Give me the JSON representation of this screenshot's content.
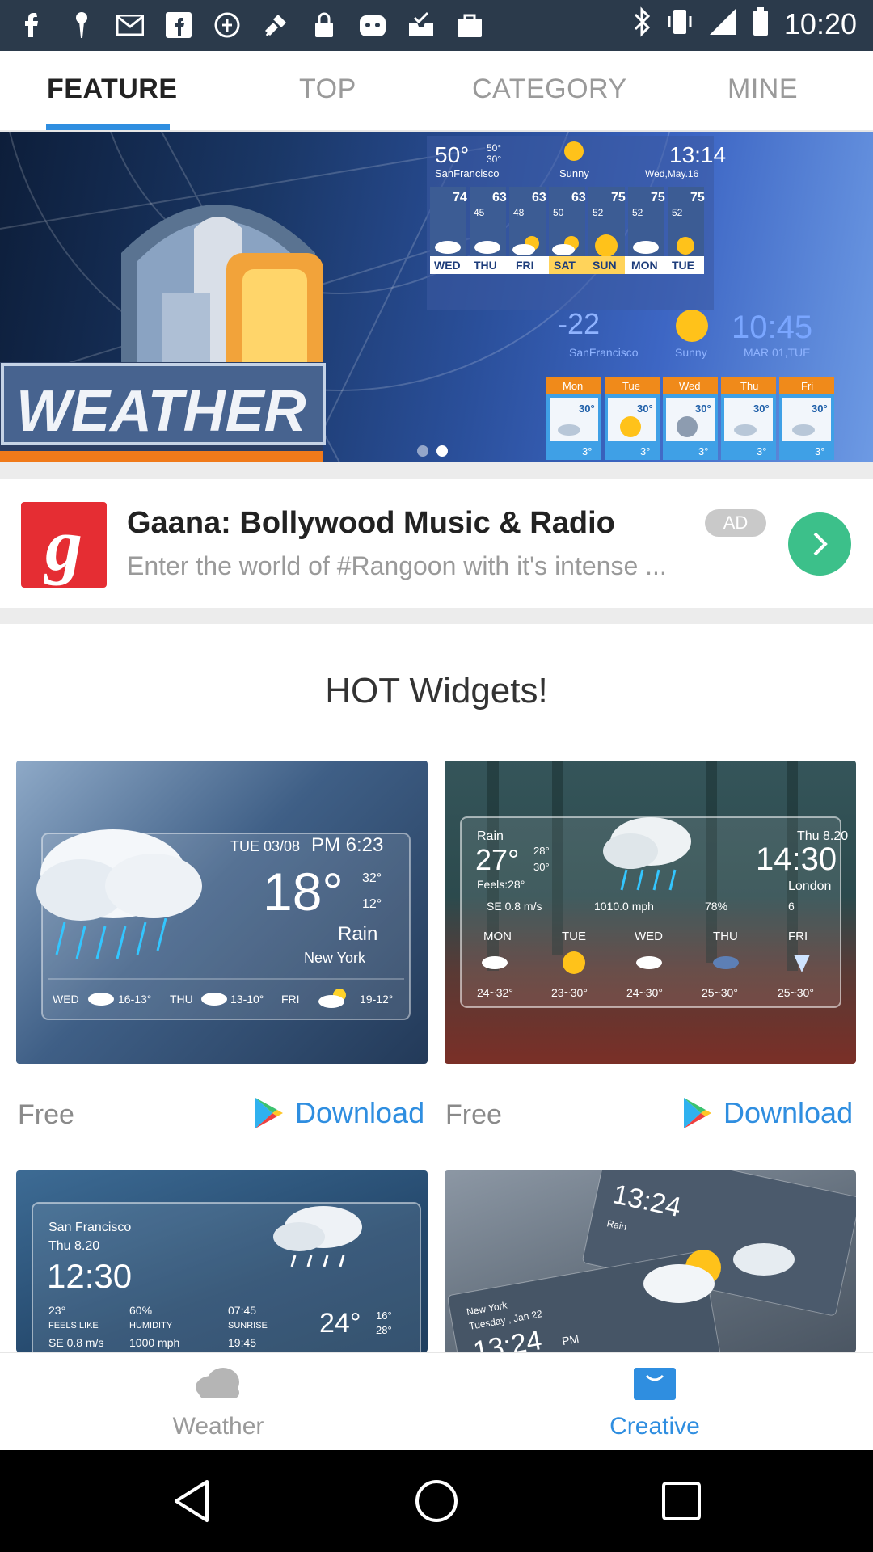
{
  "status_bar": {
    "time": "10:20",
    "icons": [
      "facebook-icon",
      "pin-icon",
      "gmail-icon",
      "facebook-icon",
      "data-saver-icon",
      "fake-gps-icon",
      "lock-icon",
      "app-icon",
      "inbox-check-icon",
      "shopping-bag-icon"
    ]
  },
  "tabs": {
    "items": [
      {
        "label": "FEATURE",
        "active": true
      },
      {
        "label": "TOP",
        "active": false
      },
      {
        "label": "CATEGORY",
        "active": false
      },
      {
        "label": "MINE",
        "active": false
      }
    ]
  },
  "banner": {
    "logo_text": "WEATHER",
    "top_widget": {
      "temp": "50°",
      "hi": "50°",
      "lo": "30°",
      "city": "SanFrancisco",
      "condition": "Sunny",
      "time": "13:14",
      "date": "Wed,May.16",
      "days": [
        "WED",
        "THU",
        "FRI",
        "SAT",
        "SUN",
        "MON",
        "TUE"
      ],
      "highs": [
        "74",
        "63",
        "63",
        "63",
        "75",
        "75",
        "75"
      ],
      "lows": [
        "",
        "45",
        "48",
        "50",
        "52",
        "52",
        "52"
      ]
    },
    "bottom_widget": {
      "temp": "-22",
      "city": "SanFrancisco",
      "condition": "Sunny",
      "time": "10:45",
      "date": "MAR 01,TUE",
      "days": [
        "Mon",
        "Tue",
        "Wed",
        "Thu",
        "Fri"
      ],
      "highs": [
        "30°",
        "30°",
        "30°",
        "30°",
        "30°"
      ],
      "lows": [
        "3°",
        "3°",
        "3°",
        "3°",
        "3°"
      ]
    },
    "page_count": 2,
    "active_page": 2
  },
  "ad": {
    "logo_letter": "g",
    "title": "Gaana: Bollywood Music & Radio",
    "badge": "AD",
    "description": "Enter the world of #Rangoon with it's intense ..."
  },
  "section": {
    "title": "HOT Widgets!"
  },
  "widgets": [
    {
      "price": "Free",
      "download_label": "Download",
      "preview": {
        "date": "TUE 03/08",
        "time": "PM 6:23",
        "temp": "18°",
        "hi": "32°",
        "lo": "12°",
        "condition": "Rain",
        "city": "New York",
        "forecast": [
          {
            "day": "WED",
            "range": "16-13°"
          },
          {
            "day": "THU",
            "range": "13-10°"
          },
          {
            "day": "FRI",
            "range": "19-12°"
          }
        ]
      }
    },
    {
      "price": "Free",
      "download_label": "Download",
      "preview": {
        "condition": "Rain",
        "temp": "27°",
        "hi": "28°",
        "lo": "30°",
        "feels": "Feels:28°",
        "date": "Thu 8.20",
        "time": "14:30",
        "city": "London",
        "stats": [
          "SE 0.8 m/s",
          "1010.0 mph",
          "78%",
          "6"
        ],
        "forecast": [
          {
            "day": "MON",
            "range": "24~32°"
          },
          {
            "day": "TUE",
            "range": "23~30°"
          },
          {
            "day": "WED",
            "range": "24~30°"
          },
          {
            "day": "THU",
            "range": "25~30°"
          },
          {
            "day": "FRI",
            "range": "25~30°"
          }
        ]
      }
    },
    {
      "preview": {
        "city": "San Francisco",
        "date": "Thu 8.20",
        "time": "12:30",
        "temp_small": "23°",
        "feels_label": "FEELS LIKE",
        "humidity": "60%",
        "humidity_label": "HUMIDITY",
        "sunrise": "07:45",
        "sunrise_label": "SUNRISE",
        "wind": "SE 0.8 m/s",
        "pressure": "1000 mph",
        "sunset": "19:45",
        "temp": "24°",
        "hi": "16°",
        "lo": "28°"
      }
    },
    {
      "preview": {
        "city": "New York",
        "date": "Tuesday , Jan 22",
        "time": "13:24",
        "ampm": "PM",
        "time_top": "13:24",
        "condition_top": "Rain"
      }
    }
  ],
  "bottom_nav": {
    "items": [
      {
        "label": "Weather",
        "icon": "cloud-icon",
        "active": false
      },
      {
        "label": "Creative",
        "icon": "bag-icon",
        "active": true
      }
    ]
  },
  "colors": {
    "accent": "#2f8ee0",
    "ad_green": "#3cc08a",
    "gaana_red": "#e52d33",
    "status_bar": "#2b3a4b"
  }
}
